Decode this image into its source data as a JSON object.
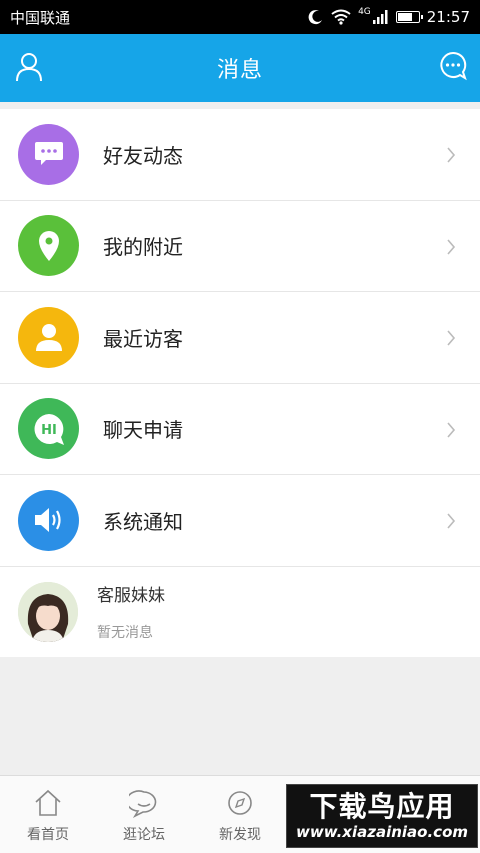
{
  "status_bar": {
    "carrier": "中国联通",
    "network": "4G",
    "time": "21:57",
    "battery_level": 0.75
  },
  "header": {
    "title": "消息",
    "left_icon": "user-icon",
    "right_icon": "chat-bubble-icon",
    "color": "#16a5e8"
  },
  "menu": [
    {
      "label": "好友动态",
      "icon": "comment-dots-icon",
      "color": "#a86ee6"
    },
    {
      "label": "我的附近",
      "icon": "location-pin-icon",
      "color": "#5ac03a"
    },
    {
      "label": "最近访客",
      "icon": "person-icon",
      "color": "#f5b70d"
    },
    {
      "label": "聊天申请",
      "icon": "hi-bubble-icon",
      "color": "#3fb858"
    },
    {
      "label": "系统通知",
      "icon": "speaker-icon",
      "color": "#2b8fe6"
    }
  ],
  "contact": {
    "name": "客服妹妹",
    "last_message": "暂无消息"
  },
  "tabs": [
    {
      "label": "看首页",
      "icon": "home-icon"
    },
    {
      "label": "逛论坛",
      "icon": "forum-icon"
    },
    {
      "label": "新发现",
      "icon": "compass-icon"
    }
  ],
  "watermark": {
    "main": "下载鸟应用",
    "url": "www.xiazainiao.com"
  }
}
